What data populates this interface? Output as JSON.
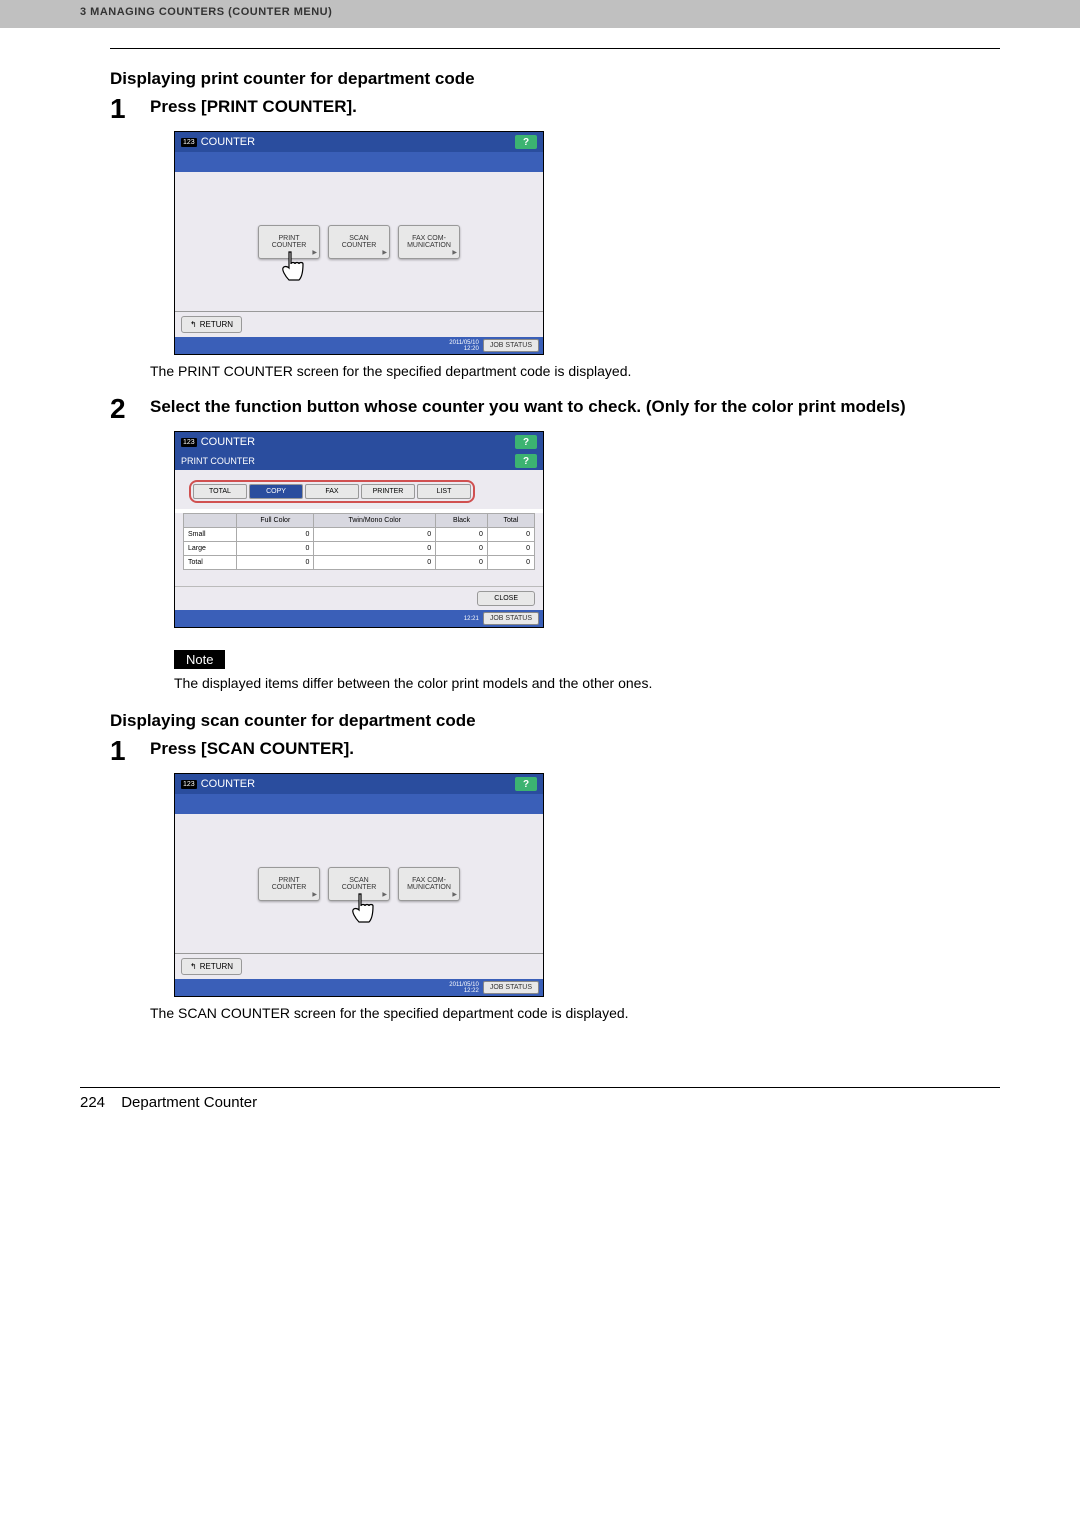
{
  "header": {
    "text": "3 MANAGING COUNTERS (COUNTER MENU)"
  },
  "section1": {
    "title": "Displaying print counter for department code",
    "step1_num": "1",
    "step1_text": "Press [PRINT COUNTER].",
    "step1_caption": "The PRINT COUNTER screen for the specified department code is displayed.",
    "step2_num": "2",
    "step2_text": "Select the function button whose counter you want to check. (Only for the color print models)"
  },
  "section2": {
    "title": "Displaying scan counter for department code",
    "step1_num": "1",
    "step1_text": "Press [SCAN COUNTER].",
    "step1_caption": "The SCAN COUNTER screen for the specified department code is displayed."
  },
  "screen_counter": {
    "icon_text": "123",
    "title": "COUNTER",
    "help": "?",
    "btn1_l1": "PRINT",
    "btn1_l2": "COUNTER",
    "btn2_l1": "SCAN",
    "btn2_l2": "COUNTER",
    "btn3_l1": "FAX COM-",
    "btn3_l2": "MUNICATION",
    "return": "RETURN",
    "date": "2011/05/10",
    "time": "12:20",
    "date2": "2011/05/10",
    "time2": "12:22",
    "job_status": "JOB STATUS"
  },
  "screen_print": {
    "title": "COUNTER",
    "sub": "PRINT COUNTER",
    "help": "?",
    "tabs": {
      "total": "TOTAL",
      "copy": "COPY",
      "fax": "FAX",
      "printer": "PRINTER",
      "list": "LIST"
    },
    "cols": {
      "c1": "Full Color",
      "c2": "Twin/Mono Color",
      "c3": "Black",
      "c4": "Total"
    },
    "rows": [
      {
        "label": "Small",
        "v1": "0",
        "v2": "0",
        "v3": "0",
        "v4": "0"
      },
      {
        "label": "Large",
        "v1": "0",
        "v2": "0",
        "v3": "0",
        "v4": "0"
      },
      {
        "label": "Total",
        "v1": "0",
        "v2": "0",
        "v3": "0",
        "v4": "0"
      }
    ],
    "close": "CLOSE",
    "time": "12:21",
    "job_status": "JOB STATUS"
  },
  "note": {
    "badge": "Note",
    "text": "The displayed items differ between the color print models and the other ones."
  },
  "footer": {
    "page": "224",
    "title": "Department Counter"
  }
}
